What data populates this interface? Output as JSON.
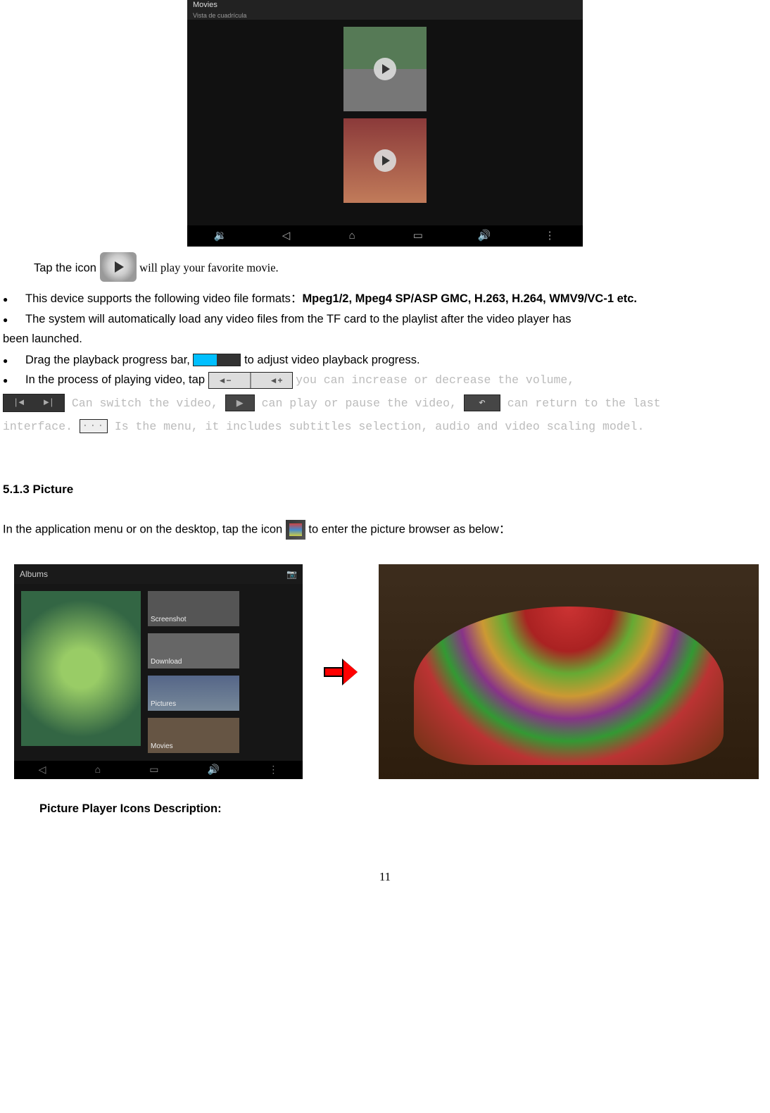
{
  "movies_screenshot": {
    "title": "Movies",
    "subtitle": "Vista de cuadrícula"
  },
  "tap_line": {
    "before": "Tap the icon ",
    "after": " will play your favorite movie."
  },
  "bullets": {
    "b1_a": "This device supports the following video file formats：",
    "b1_b": "Mpeg1/2, Mpeg4 SP/ASP GMC, H.263, H.264, WMV9/VC-1 etc.",
    "b2": "The system will automatically load any video files from the TF card to the playlist after the video player has",
    "b2_cont": "been launched.",
    "b3_a": "Drag the playback progress bar, ",
    "b3_b": " to adjust video playback progress.",
    "b4_a": "In the process of playing video, tap ",
    "b4_b": " you can increase or decrease the volume,",
    "b4_c": " Can switch the video, ",
    "b4_d": " can play or pause the video, ",
    "b4_e": " can return to the last",
    "b4_f": "interface. ",
    "b4_g": " Is the menu, it includes subtitles selection, audio and video scaling model.",
    "vol_minus": "◄−",
    "vol_plus": "◄+",
    "prev": "|◄",
    "next": "►|",
    "play": "▶",
    "back": "↶",
    "menu": "···"
  },
  "section_title": "5.1.3 Picture",
  "picture_line": {
    "before": "In the application menu or on the desktop, tap the icon ",
    "after": " to enter the picture browser as below："
  },
  "albums": {
    "title": "Albums",
    "camera": "📷",
    "folders": {
      "screenshot": "Screenshot",
      "download": "Download",
      "pictures": "Pictures",
      "movies": "Movies"
    }
  },
  "subhead": "Picture Player Icons Description:",
  "page_number": "11"
}
